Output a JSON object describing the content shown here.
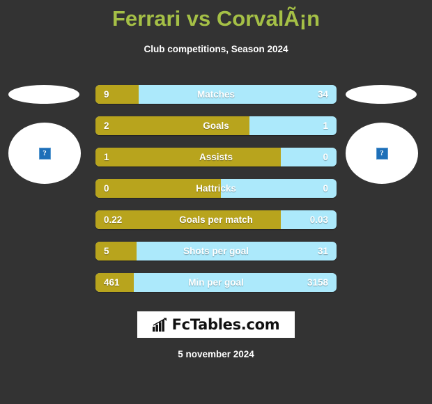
{
  "header": {
    "title": "Ferrari vs CorvalÃ¡n",
    "subtitle": "Club competitions, Season 2024"
  },
  "players": {
    "home": {
      "photo_alt": "?"
    },
    "away": {
      "photo_alt": "?"
    }
  },
  "colors": {
    "background": "#333333",
    "title": "#a5c046",
    "home_bar": "#b8a41d",
    "away_bar": "#ace9fb",
    "text": "#ffffff"
  },
  "footer": {
    "logo_text": "FcTables.com",
    "logo_icon": "bar-chart-icon",
    "date": "5 november 2024"
  },
  "chart_data": {
    "type": "bar",
    "title": "Ferrari vs CorvalÃ¡n",
    "subtitle": "Club competitions, Season 2024",
    "orientation": "horizontal-diverging",
    "categories": [
      "Matches",
      "Goals",
      "Assists",
      "Hattricks",
      "Goals per match",
      "Shots per goal",
      "Min per goal"
    ],
    "series": [
      {
        "name": "Ferrari",
        "color": "#b8a41d",
        "values": [
          "9",
          "2",
          "1",
          "0",
          "0.22",
          "5",
          "461"
        ]
      },
      {
        "name": "CorvalÃ¡n",
        "color": "#ace9fb",
        "values": [
          "34",
          "1",
          "0",
          "0",
          "0.03",
          "31",
          "3158"
        ]
      }
    ],
    "home_share_percent": [
      18,
      64,
      77,
      52,
      77,
      17,
      16
    ],
    "legend": "none",
    "grid": false
  },
  "rows": [
    {
      "label": "Matches",
      "home": "9",
      "away": "34",
      "home_pct": 18
    },
    {
      "label": "Goals",
      "home": "2",
      "away": "1",
      "home_pct": 64
    },
    {
      "label": "Assists",
      "home": "1",
      "away": "0",
      "home_pct": 77
    },
    {
      "label": "Hattricks",
      "home": "0",
      "away": "0",
      "home_pct": 52
    },
    {
      "label": "Goals per match",
      "home": "0.22",
      "away": "0.03",
      "home_pct": 77
    },
    {
      "label": "Shots per goal",
      "home": "5",
      "away": "31",
      "home_pct": 17
    },
    {
      "label": "Min per goal",
      "home": "461",
      "away": "3158",
      "home_pct": 16
    }
  ]
}
